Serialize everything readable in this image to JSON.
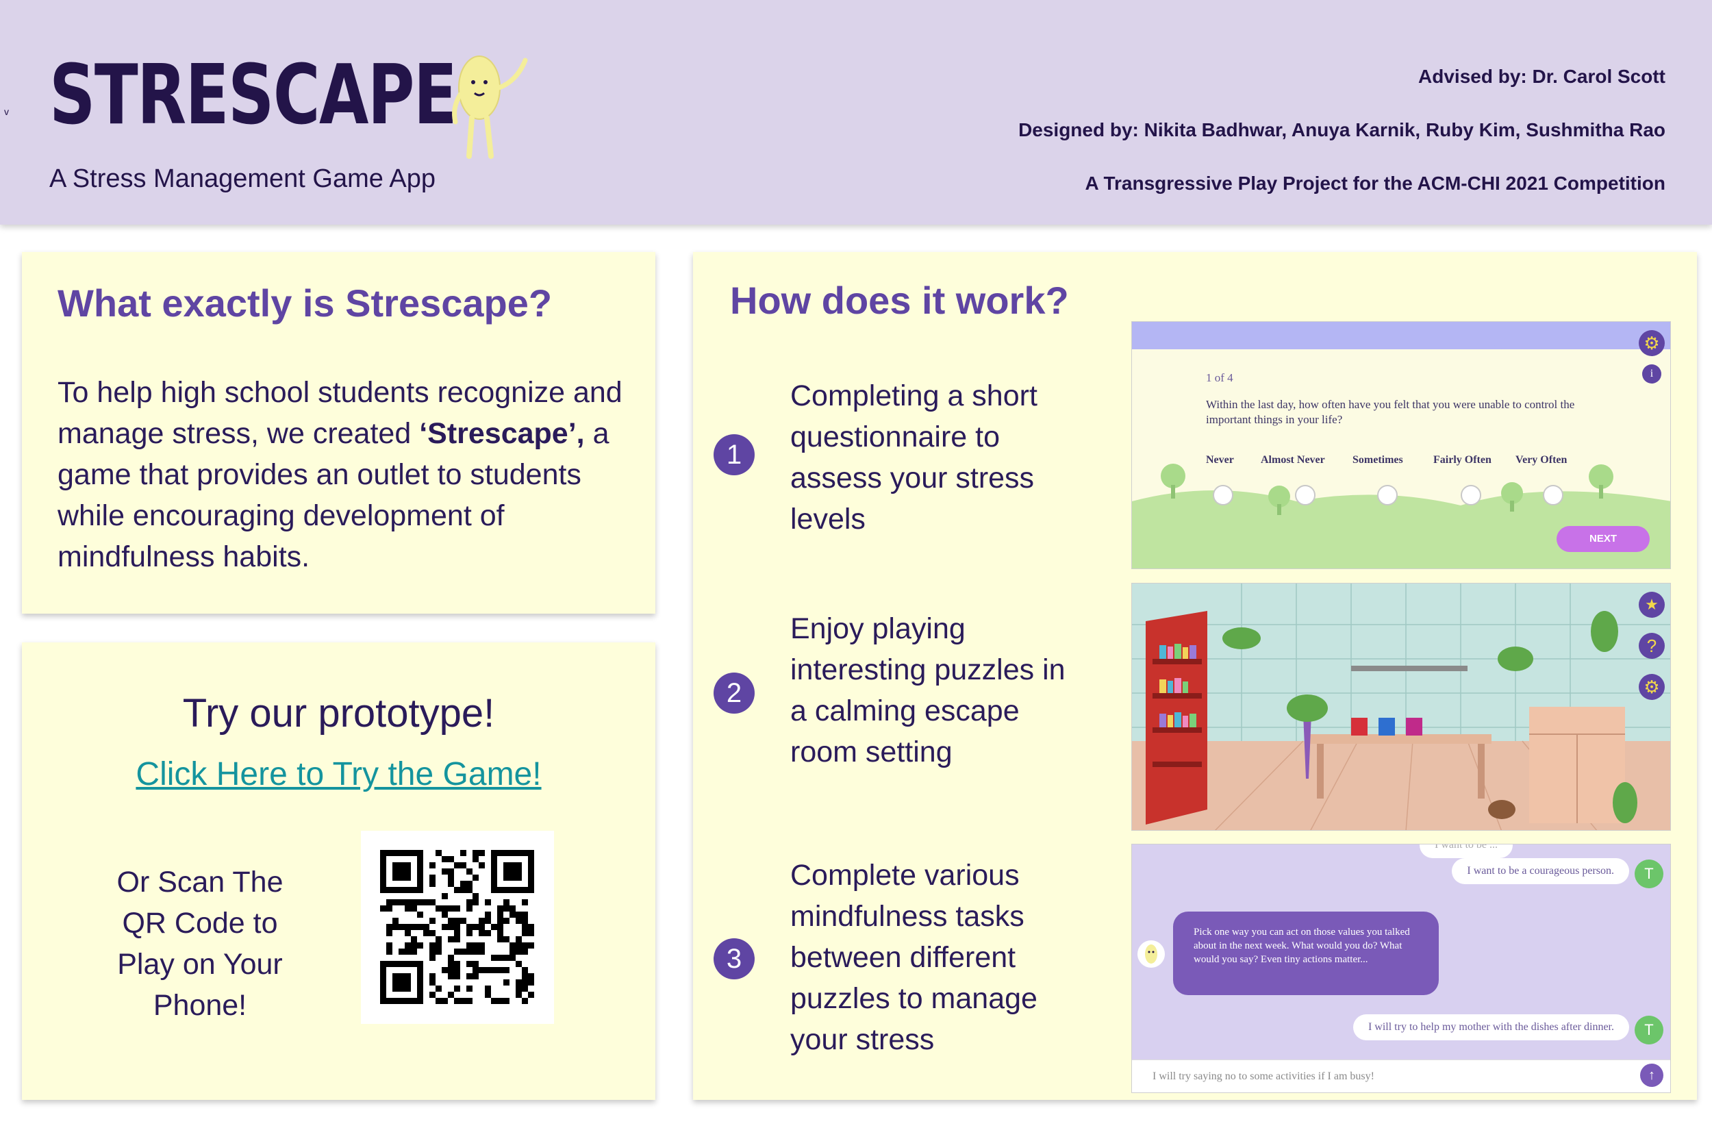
{
  "header": {
    "title": "STRESCAPE",
    "tagline": "A Stress Management Game App",
    "advised": "Advised by: Dr. Carol Scott",
    "designed": "Designed by: Nikita Badhwar, Anuya Karnik, Ruby Kim, Sushmitha Rao",
    "project": "A Transgressive Play Project for the ACM-CHI 2021 Competition",
    "mark": "v"
  },
  "what": {
    "heading": "What exactly is Strescape?",
    "body_pre": "To help high school students recognize and manage stress, we created ",
    "body_bold": "‘Strescape’,",
    "body_post": " a game that provides an outlet to students while encouraging development of mindfulness habits."
  },
  "try": {
    "title": "Try our prototype!",
    "link": "Click Here to Try the Game!",
    "scan": "Or Scan The QR Code to Play on Your Phone!"
  },
  "how": {
    "heading": "How does it work?",
    "steps": [
      {
        "num": "1",
        "text": "Completing a short questionnaire to assess your stress levels"
      },
      {
        "num": "2",
        "text": "Enjoy playing interesting puzzles in a calming escape room setting"
      },
      {
        "num": "3",
        "text": "Complete various mindfulness tasks between different puzzles to manage your stress"
      }
    ]
  },
  "questionnaire": {
    "counter": "1 of 4",
    "question": "Within the last day, how often have you felt that you were unable to control the important things in your life?",
    "options": [
      "Never",
      "Almost Never",
      "Sometimes",
      "Fairly Often",
      "Very Often"
    ],
    "next": "NEXT",
    "info": "i"
  },
  "chat": {
    "top_partial": "I want to be ... ",
    "msg1": "I want to be a courageous person.",
    "bot": "Pick one way you can act on those values you talked about in the next week. What would you do? What would you say? Even tiny actions matter...",
    "msg2": "I will try to help my mother with the dishes after dinner.",
    "input": "I will try saying no to some activities if I am busy!",
    "avatar": "T"
  },
  "colors": {
    "header_bg": "#dbd3ea",
    "panel_bg": "#fefedb",
    "accent": "#5f45a3",
    "link": "#14949e"
  }
}
